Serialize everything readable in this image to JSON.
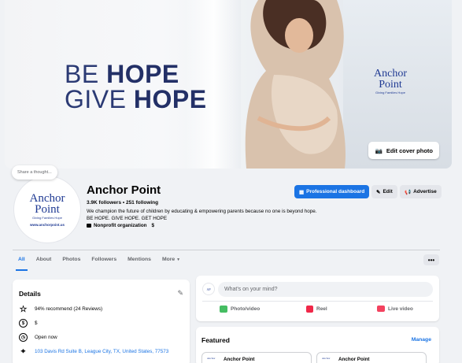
{
  "cover": {
    "slogan_line1_a": "BE ",
    "slogan_line1_b": "HOPE",
    "slogan_line2_a": "GIVE ",
    "slogan_line2_b": "HOPE",
    "logo_name": "Anchor Point",
    "logo_tagline": "Giving Families Hope",
    "edit_cover_label": "Edit cover photo"
  },
  "profile": {
    "thought_bubble": "Share a thought...",
    "avatar_name": "Anchor Point",
    "avatar_tagline": "Giving Families Hope",
    "avatar_url": "www.anchorpoint.us",
    "name": "Anchor Point",
    "stats": "3.9K followers • 251 following",
    "bio_line1": "We champion the future of children by educating & empowering parents because no one is beyond hope.",
    "bio_line2": "BE HOPE. GIVE HOPE. GET HOPE",
    "category": "Nonprofit organization",
    "price": "$"
  },
  "actions": {
    "dashboard": "Professional dashboard",
    "edit": "Edit",
    "advertise": "Advertise"
  },
  "tabs": [
    "All",
    "About",
    "Photos",
    "Followers",
    "Mentions",
    "More"
  ],
  "more_dots": "•••",
  "details": {
    "title": "Details",
    "recommend": "94% recommend (24 Reviews)",
    "price": "$",
    "hours": "Open now",
    "address": "103 Davis Rd Suite B, League City, TX, United States, 77573"
  },
  "composer": {
    "placeholder": "What's on your mind?",
    "photo": "Photo/video",
    "reel": "Reel",
    "live": "Live video"
  },
  "featured": {
    "title": "Featured",
    "manage": "Manage",
    "item1": "Anchor Point",
    "item2": "Anchor Point"
  },
  "colors": {
    "accent": "#1b74e4",
    "brand_navy": "#233067",
    "background": "#f0f2f5"
  }
}
